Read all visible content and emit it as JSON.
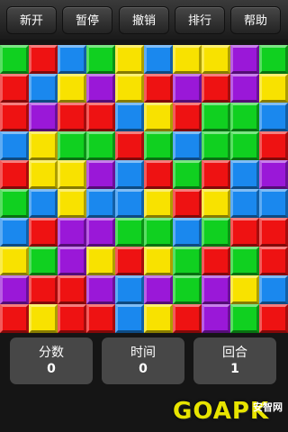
{
  "toolbar": {
    "buttons": [
      {
        "label": "新开"
      },
      {
        "label": "暂停"
      },
      {
        "label": "撤销"
      },
      {
        "label": "排行"
      },
      {
        "label": "帮助"
      }
    ]
  },
  "board": {
    "rows": 10,
    "cols": 10,
    "palette": {
      "G": "#10d020",
      "R": "#ee1212",
      "B": "#1a88ee",
      "Y": "#f8e200",
      "P": "#9a18d8"
    },
    "grid": [
      [
        "G",
        "R",
        "B",
        "G",
        "Y",
        "B",
        "Y",
        "Y",
        "P",
        "G"
      ],
      [
        "R",
        "B",
        "Y",
        "P",
        "Y",
        "R",
        "P",
        "R",
        "P",
        "Y"
      ],
      [
        "R",
        "P",
        "R",
        "R",
        "B",
        "Y",
        "R",
        "G",
        "G",
        "B"
      ],
      [
        "B",
        "Y",
        "G",
        "G",
        "R",
        "G",
        "B",
        "G",
        "G",
        "R"
      ],
      [
        "R",
        "Y",
        "Y",
        "P",
        "B",
        "R",
        "G",
        "R",
        "B",
        "P"
      ],
      [
        "G",
        "B",
        "Y",
        "B",
        "B",
        "Y",
        "R",
        "Y",
        "B",
        "B"
      ],
      [
        "B",
        "R",
        "P",
        "P",
        "G",
        "G",
        "B",
        "G",
        "R",
        "R"
      ],
      [
        "Y",
        "G",
        "P",
        "Y",
        "R",
        "Y",
        "G",
        "R",
        "G",
        "R"
      ],
      [
        "P",
        "R",
        "R",
        "P",
        "B",
        "P",
        "G",
        "P",
        "Y",
        "B"
      ],
      [
        "R",
        "Y",
        "R",
        "R",
        "B",
        "Y",
        "R",
        "P",
        "G",
        "R"
      ]
    ]
  },
  "stats": {
    "score": {
      "label": "分数",
      "value": "0"
    },
    "time": {
      "label": "时间",
      "value": "0"
    },
    "round": {
      "label": "回合",
      "value": "1"
    }
  },
  "watermark": {
    "brand": "GOAPK",
    "sub": "安智网"
  }
}
